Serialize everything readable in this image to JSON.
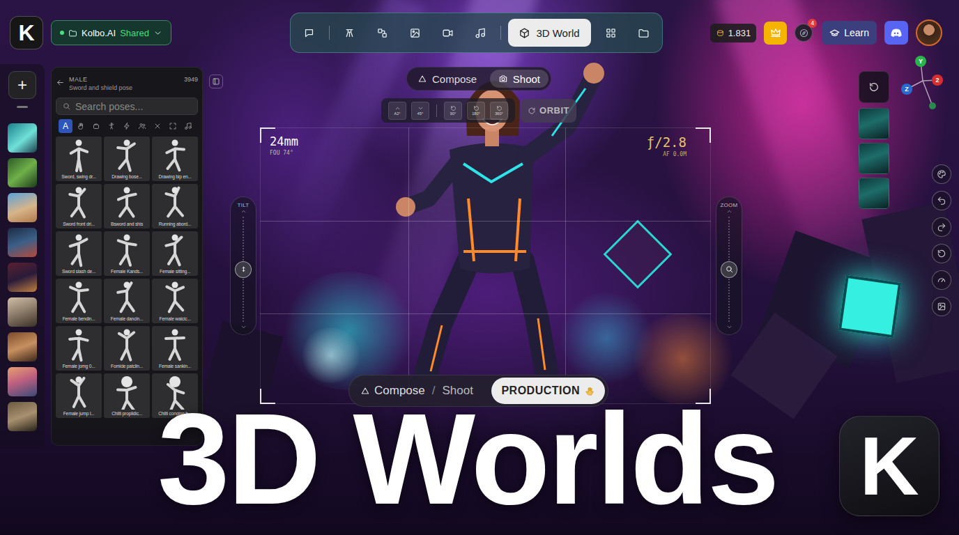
{
  "app": {
    "logo": "K",
    "workspace": {
      "name": "Kolbo.AI",
      "status": "Shared"
    }
  },
  "toolbar": {
    "items": [
      {
        "selected": false
      },
      {
        "selected": false
      },
      {
        "selected": false
      },
      {
        "selected": false
      },
      {
        "selected": false
      },
      {
        "selected": false
      },
      {
        "label": "3D World",
        "selected": true
      },
      {
        "selected": false
      },
      {
        "selected": false
      }
    ]
  },
  "header": {
    "credits": "1.831",
    "notification_count": "4",
    "learn": "Learn"
  },
  "axis_gizmo": {
    "y": "Y",
    "z": "Z",
    "x": "2"
  },
  "sidebar": {
    "add_button": "+"
  },
  "pose_panel": {
    "category": "MALE",
    "title": "Sword and shield pose",
    "count": "3949",
    "search": {
      "placeholder": "Search poses..."
    },
    "filters": [
      {
        "label": "A",
        "selected": true
      },
      {
        "selected": false
      },
      {
        "selected": false
      },
      {
        "selected": false
      },
      {
        "selected": false
      },
      {
        "selected": false
      },
      {
        "selected": false
      },
      {
        "selected": false
      },
      {
        "selected": false
      }
    ],
    "poses": [
      {
        "label": "Sword, swing dr..."
      },
      {
        "label": "Drawing bose..."
      },
      {
        "label": "Drawing bip en..."
      },
      {
        "label": "Sword front dri..."
      },
      {
        "label": "Bsword and shis"
      },
      {
        "label": "Running abord..."
      },
      {
        "label": "Sword slash de..."
      },
      {
        "label": "Female Kands..."
      },
      {
        "label": "Female sitting..."
      },
      {
        "label": "Female bendin..."
      },
      {
        "label": "Female dancin..."
      },
      {
        "label": "Female waicic..."
      },
      {
        "label": "Female jomg 0..."
      },
      {
        "label": "Fomide patclin..."
      },
      {
        "label": "Female sankin..."
      },
      {
        "label": "Female jump l..."
      },
      {
        "label": "Chilti proplidic..."
      },
      {
        "label": "Chilti conging h..."
      }
    ]
  },
  "view_mode": {
    "tabs": [
      {
        "label": "Compose",
        "selected": false
      },
      {
        "label": "Shoot",
        "selected": true
      }
    ]
  },
  "camera_presets": {
    "buttons": [
      {
        "label": "A2°",
        "kind": "tilt"
      },
      {
        "label": "45°",
        "kind": "tilt"
      },
      {
        "label": "90°",
        "kind": "rotate"
      },
      {
        "label": "180°",
        "kind": "rotate"
      },
      {
        "label": "360°",
        "kind": "rotate"
      }
    ],
    "orbit": "ORBIT"
  },
  "viewport": {
    "focal_length": "24mm",
    "fov": "FOU 74°",
    "aperture": "ƒ/2.8",
    "focus": "AF 0.0M"
  },
  "tilt": {
    "label": "TILT",
    "level": 0.5
  },
  "zoom": {
    "label": "ZOOM",
    "level": 0.5
  },
  "stage_switch": {
    "left": {
      "compose": "Compose",
      "separator": "/",
      "shoot": "Shoot",
      "selected": false
    },
    "right": {
      "label": "PRODUCTION",
      "selected": true
    }
  },
  "title": "3D Worlds",
  "brand_badge": "K"
}
